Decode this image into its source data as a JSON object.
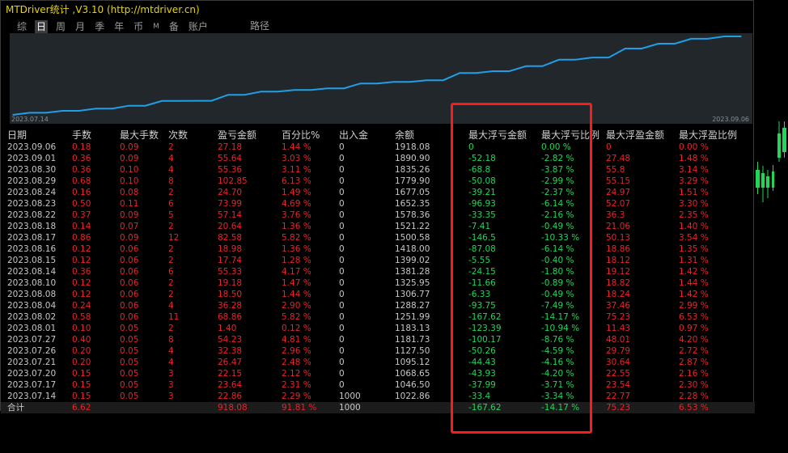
{
  "window": {
    "title": "MTDriver统计 ,V3.10 (http://mtdriver.cn)"
  },
  "tabs": [
    {
      "label": "综",
      "active": false
    },
    {
      "label": "日",
      "active": true
    },
    {
      "label": "周",
      "active": false
    },
    {
      "label": "月",
      "active": false
    },
    {
      "label": "季",
      "active": false
    },
    {
      "label": "年",
      "active": false
    },
    {
      "label": "币",
      "active": false
    },
    {
      "label": "M",
      "active": false
    },
    {
      "label": "备",
      "active": false
    },
    {
      "label": "账户",
      "active": false
    }
  ],
  "path_tab": "路径",
  "chart_data": {
    "type": "line",
    "x_start_label": "2023.07.14",
    "x_end_label": "2023.09.06",
    "color": "#1ea0e6",
    "x": [
      "2023.07.14",
      "2023.07.17",
      "2023.07.20",
      "2023.07.21",
      "2023.07.26",
      "2023.07.27",
      "2023.08.01",
      "2023.08.02",
      "2023.08.04",
      "2023.08.08",
      "2023.08.10",
      "2023.08.14",
      "2023.08.15",
      "2023.08.16",
      "2023.08.17",
      "2023.08.18",
      "2023.08.22",
      "2023.08.23",
      "2023.08.24",
      "2023.08.29",
      "2023.08.30",
      "2023.09.01",
      "2023.09.06"
    ],
    "values": [
      1022.86,
      1046.5,
      1068.65,
      1095.12,
      1127.5,
      1181.73,
      1183.13,
      1251.99,
      1288.27,
      1306.77,
      1325.95,
      1381.28,
      1399.02,
      1418.0,
      1500.58,
      1521.22,
      1578.36,
      1652.35,
      1677.05,
      1779.9,
      1835.26,
      1890.9,
      1918.08
    ]
  },
  "table": {
    "headers": [
      "日期",
      "手数",
      "最大手数",
      "次数",
      "盈亏金额",
      "百分比%",
      "出入金",
      "余额",
      "最大浮亏金额",
      "最大浮亏比例",
      "最大浮盈金额",
      "最大浮盈比例"
    ],
    "rows": [
      [
        "2023.09.06",
        "0.18",
        "0.09",
        "2",
        "27.18",
        "1.44 %",
        "0",
        "1918.08",
        "0",
        "0.00 %",
        "0",
        "0.00 %"
      ],
      [
        "2023.09.01",
        "0.36",
        "0.09",
        "4",
        "55.64",
        "3.03 %",
        "0",
        "1890.90",
        "-52.18",
        "-2.82 %",
        "27.48",
        "1.48 %"
      ],
      [
        "2023.08.30",
        "0.36",
        "0.10",
        "4",
        "55.36",
        "3.11 %",
        "0",
        "1835.26",
        "-68.8",
        "-3.87 %",
        "55.8",
        "3.14 %"
      ],
      [
        "2023.08.29",
        "0.68",
        "0.10",
        "8",
        "102.85",
        "6.13 %",
        "0",
        "1779.90",
        "-50.08",
        "-2.99 %",
        "55.15",
        "3.29 %"
      ],
      [
        "2023.08.24",
        "0.16",
        "0.08",
        "2",
        "24.70",
        "1.49 %",
        "0",
        "1677.05",
        "-39.21",
        "-2.37 %",
        "24.97",
        "1.51 %"
      ],
      [
        "2023.08.23",
        "0.50",
        "0.11",
        "6",
        "73.99",
        "4.69 %",
        "0",
        "1652.35",
        "-96.93",
        "-6.14 %",
        "52.07",
        "3.30 %"
      ],
      [
        "2023.08.22",
        "0.37",
        "0.09",
        "5",
        "57.14",
        "3.76 %",
        "0",
        "1578.36",
        "-33.35",
        "-2.16 %",
        "36.3",
        "2.35 %"
      ],
      [
        "2023.08.18",
        "0.14",
        "0.07",
        "2",
        "20.64",
        "1.36 %",
        "0",
        "1521.22",
        "-7.41",
        "-0.49 %",
        "21.06",
        "1.40 %"
      ],
      [
        "2023.08.17",
        "0.86",
        "0.09",
        "12",
        "82.58",
        "5.82 %",
        "0",
        "1500.58",
        "-146.5",
        "-10.33 %",
        "50.13",
        "3.54 %"
      ],
      [
        "2023.08.16",
        "0.12",
        "0.06",
        "2",
        "18.98",
        "1.36 %",
        "0",
        "1418.00",
        "-87.08",
        "-6.14 %",
        "18.86",
        "1.35 %"
      ],
      [
        "2023.08.15",
        "0.12",
        "0.06",
        "2",
        "17.74",
        "1.28 %",
        "0",
        "1399.02",
        "-5.55",
        "-0.40 %",
        "18.12",
        "1.31 %"
      ],
      [
        "2023.08.14",
        "0.36",
        "0.06",
        "6",
        "55.33",
        "4.17 %",
        "0",
        "1381.28",
        "-24.15",
        "-1.80 %",
        "19.12",
        "1.42 %"
      ],
      [
        "2023.08.10",
        "0.12",
        "0.06",
        "2",
        "19.18",
        "1.47 %",
        "0",
        "1325.95",
        "-11.66",
        "-0.89 %",
        "18.82",
        "1.44 %"
      ],
      [
        "2023.08.08",
        "0.12",
        "0.06",
        "2",
        "18.50",
        "1.44 %",
        "0",
        "1306.77",
        "-6.33",
        "-0.49 %",
        "18.24",
        "1.42 %"
      ],
      [
        "2023.08.04",
        "0.24",
        "0.06",
        "4",
        "36.28",
        "2.90 %",
        "0",
        "1288.27",
        "-93.75",
        "-7.49 %",
        "37.46",
        "2.99 %"
      ],
      [
        "2023.08.02",
        "0.58",
        "0.06",
        "11",
        "68.86",
        "5.82 %",
        "0",
        "1251.99",
        "-167.62",
        "-14.17 %",
        "75.23",
        "6.53 %"
      ],
      [
        "2023.08.01",
        "0.10",
        "0.05",
        "2",
        "1.40",
        "0.12 %",
        "0",
        "1183.13",
        "-123.39",
        "-10.94 %",
        "11.43",
        "0.97 %"
      ],
      [
        "2023.07.27",
        "0.40",
        "0.05",
        "8",
        "54.23",
        "4.81 %",
        "0",
        "1181.73",
        "-100.17",
        "-8.76 %",
        "48.01",
        "4.20 %"
      ],
      [
        "2023.07.26",
        "0.20",
        "0.05",
        "4",
        "32.38",
        "2.96 %",
        "0",
        "1127.50",
        "-50.26",
        "-4.59 %",
        "29.79",
        "2.72 %"
      ],
      [
        "2023.07.21",
        "0.20",
        "0.05",
        "4",
        "26.47",
        "2.48 %",
        "0",
        "1095.12",
        "-44.43",
        "-4.16 %",
        "30.64",
        "2.87 %"
      ],
      [
        "2023.07.20",
        "0.15",
        "0.05",
        "3",
        "22.15",
        "2.12 %",
        "0",
        "1068.65",
        "-43.93",
        "-4.20 %",
        "22.55",
        "2.16 %"
      ],
      [
        "2023.07.17",
        "0.15",
        "0.05",
        "3",
        "23.64",
        "2.31 %",
        "0",
        "1046.50",
        "-37.99",
        "-3.71 %",
        "23.54",
        "2.30 %"
      ],
      [
        "2023.07.14",
        "0.15",
        "0.05",
        "3",
        "22.86",
        "2.29 %",
        "1000",
        "1022.86",
        "-33.4",
        "-3.34 %",
        "22.77",
        "2.28 %"
      ]
    ],
    "total": [
      "合计",
      "6.62",
      "",
      "",
      "918.08",
      "91.81 %",
      "1000",
      "",
      "-167.62",
      "-14.17 %",
      "75.23",
      "6.53 %"
    ]
  },
  "colors": {
    "title": "#e8d400",
    "positive": "#e8242a",
    "drawdown": "#22d65a",
    "neutral": "#c8c8c8",
    "highlight": "#ff1a1a"
  }
}
